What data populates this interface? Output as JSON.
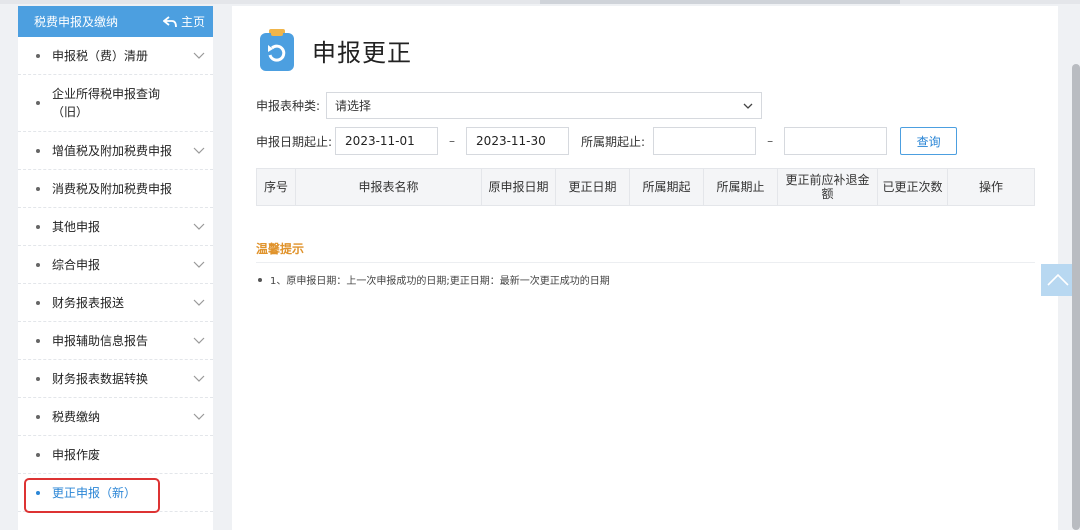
{
  "sidebar": {
    "header_title": "税费申报及缴纳",
    "home_label": "主页",
    "items": [
      {
        "label": "申报税（费）清册",
        "has_chevron": true
      },
      {
        "label": "企业所得税申报查询（旧）",
        "has_chevron": false
      },
      {
        "label": "增值税及附加税费申报",
        "has_chevron": true
      },
      {
        "label": "消费税及附加税费申报",
        "has_chevron": false
      },
      {
        "label": "其他申报",
        "has_chevron": true
      },
      {
        "label": "综合申报",
        "has_chevron": true
      },
      {
        "label": "财务报表报送",
        "has_chevron": true
      },
      {
        "label": "申报辅助信息报告",
        "has_chevron": true
      },
      {
        "label": "财务报表数据转换",
        "has_chevron": true
      },
      {
        "label": "税费缴纳",
        "has_chevron": true
      },
      {
        "label": "申报作废",
        "has_chevron": false
      },
      {
        "label": "更正申报（新）",
        "has_chevron": false,
        "active": true
      }
    ]
  },
  "main": {
    "page_title": "申报更正",
    "form": {
      "type_label": "申报表种类:",
      "type_value": "请选择",
      "date_label": "申报日期起止:",
      "date_start": "2023-11-01",
      "date_end": "2023-11-30",
      "period_label": "所属期起止:",
      "period_start": "",
      "period_end": "",
      "range_sep": "–",
      "query_button": "查询"
    },
    "table": {
      "columns": [
        "序号",
        "申报表名称",
        "原申报日期",
        "更正日期",
        "所属期起",
        "所属期止",
        "更正前应补退金额",
        "已更正次数",
        "操作"
      ]
    },
    "tips": {
      "title": "温馨提示",
      "items": [
        "1、原申报日期：上一次申报成功的日期;更正日期：最新一次更正成功的日期"
      ]
    }
  },
  "colors": {
    "accent": "#4c9fe0",
    "active_text": "#2b86d6",
    "tips_title": "#e0932c",
    "highlight_box": "#dd3333"
  }
}
